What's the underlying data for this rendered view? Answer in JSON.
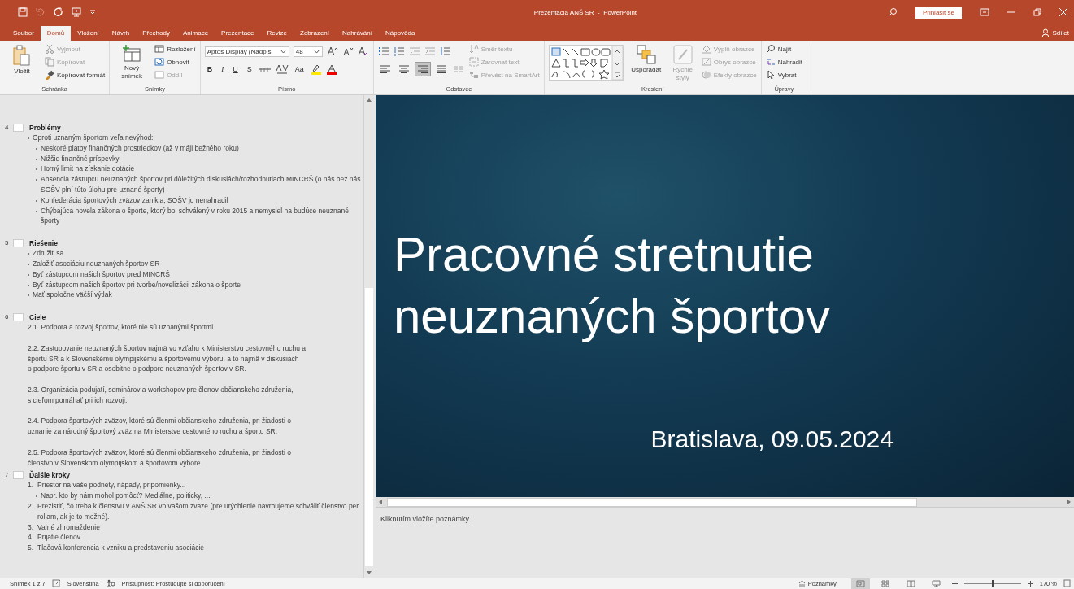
{
  "window": {
    "title": "Prezentácia ANŠ SR  -  PowerPoint",
    "sign_in": "Přihlásit se",
    "share": "Sdílet"
  },
  "tabs": [
    {
      "label": "Soubor",
      "selected": false
    },
    {
      "label": "Domů",
      "selected": true
    },
    {
      "label": "Vložení",
      "selected": false
    },
    {
      "label": "Návrh",
      "selected": false
    },
    {
      "label": "Přechody",
      "selected": false
    },
    {
      "label": "Animace",
      "selected": false
    },
    {
      "label": "Prezentace",
      "selected": false
    },
    {
      "label": "Revize",
      "selected": false
    },
    {
      "label": "Zobrazení",
      "selected": false
    },
    {
      "label": "Nahrávání",
      "selected": false
    },
    {
      "label": "Nápověda",
      "selected": false
    }
  ],
  "ribbon": {
    "groups": [
      {
        "kind": "clipboard",
        "label": "Schránka",
        "big": "Vložit",
        "commands": [
          {
            "label": "Vyjmout",
            "disabled": true
          },
          {
            "label": "Kopírovat",
            "disabled": true
          },
          {
            "label": "Kopírovat formát",
            "disabled": false
          }
        ]
      },
      {
        "kind": "slides",
        "label": "Snímky",
        "big": "Nový snímek",
        "commands": [
          {
            "label": "Rozložení",
            "disabled": false
          },
          {
            "label": "Obnovit",
            "disabled": false
          },
          {
            "label": "Oddíl",
            "disabled": true
          }
        ]
      },
      {
        "kind": "font",
        "label": "Písmo",
        "font_name": "Aptos Display (Nadpis",
        "font_size": "48",
        "format_buttons": [
          "B",
          "I",
          "U",
          "S"
        ],
        "case": "Aa"
      },
      {
        "kind": "paragraph",
        "label": "Odstavec",
        "alignment": [
          {
            "selected": false
          },
          {
            "selected": false
          },
          {
            "selected": true
          },
          {
            "selected": false
          }
        ],
        "commands": [
          {
            "label": "Směr textu",
            "disabled": true
          },
          {
            "label": "Zarovnat text",
            "disabled": true
          },
          {
            "label": "Převést na SmartArt",
            "disabled": true
          }
        ]
      },
      {
        "kind": "drawing",
        "label": "Kreslení",
        "big": "Uspořádat",
        "quick_styles": "Rychlé styly",
        "commands": [
          {
            "label": "Výplň obrazce",
            "disabled": true
          },
          {
            "label": "Obrys obrazce",
            "disabled": true
          },
          {
            "label": "Efekty obrazce",
            "disabled": true
          }
        ]
      },
      {
        "kind": "editing",
        "label": "Úpravy",
        "commands": [
          {
            "label": "Najít",
            "disabled": false
          },
          {
            "label": "Nahradit",
            "disabled": false
          },
          {
            "label": "Vybrat",
            "disabled": false
          }
        ]
      }
    ]
  },
  "outline": {
    "slides": [
      {
        "number": "4",
        "title": "Problémy",
        "items": [
          {
            "kind": "bullet",
            "text": "Oproti uznaným športom veľa nevýhod:",
            "children": [
              {
                "kind": "bullet",
                "text": "Neskoré platby finančných prostriedkov (až v máji bežného roku)"
              },
              {
                "kind": "bullet",
                "text": "Nižšie finančné príspevky"
              },
              {
                "kind": "bullet",
                "text": "Horný limit na získanie dotácie"
              },
              {
                "kind": "bullet",
                "text": "Absencia zástupcu neuznaných športov pri dôležitých diskusiách/rozhodnutiach MINCRŠ (o nás bez nás. SOŠV plní túto úlohu pre uznané športy)"
              },
              {
                "kind": "bullet",
                "text": "Konfederácia športových zväzov zanikla, SOŠV ju nenahradil"
              },
              {
                "kind": "bullet",
                "text": "Chýbajúca novela zákona o športe, ktorý bol schválený v roku 2015 a nemyslel na budúce neuznané športy"
              }
            ]
          }
        ]
      },
      {
        "number": "5",
        "title": "Riešenie",
        "items": [
          {
            "kind": "bullet",
            "text": "Združiť sa"
          },
          {
            "kind": "bullet",
            "text": "Založiť asociáciu neuznaných športov SR"
          },
          {
            "kind": "bullet",
            "text": "Byť zástupcom našich športov pred MINCRŠ"
          },
          {
            "kind": "bullet",
            "text": "Byť zástupcom našich športov pri tvorbe/novelizácii zákona o športe"
          },
          {
            "kind": "bullet",
            "text": "Mať spoločne väčší výtlak"
          }
        ]
      },
      {
        "number": "6",
        "title": "Ciele",
        "items": [
          {
            "kind": "paragraph",
            "lines": [
              "2.1. Podpora a rozvoj športov, ktoré nie sú uznanými športmi"
            ]
          },
          {
            "kind": "paragraph",
            "lines": [
              "2.2. Zastupovanie neuznaných športov najmä vo vzťahu k Ministerstvu cestovného ruchu a",
              "športu SR a k Slovenskému olympijskému a športovému výboru, a to najmä v diskusiách",
              "o podpore športu v SR a osobitne o podpore neuznaných športov v SR."
            ]
          },
          {
            "kind": "paragraph",
            "lines": [
              "2.3. Organizácia podujatí, seminárov a workshopov pre členov občianskeho združenia,",
              "s cieľom pomáhať pri ich rozvoji."
            ]
          },
          {
            "kind": "paragraph",
            "lines": [
              "2.4. Podpora športových zväzov, ktoré sú členmi občianskeho združenia, pri žiadosti o",
              "uznanie za národný športový zväz na Ministerstve cestovného ruchu a športu SR."
            ]
          },
          {
            "kind": "paragraph",
            "lines": [
              "2.5. Podpora športových zväzov, ktoré sú členmi občianskeho združenia, pri žiadosti o",
              "členstvo v Slovenskom olympijskom a športovom výbore."
            ]
          }
        ]
      },
      {
        "number": "7",
        "title": "Ďalšie kroky",
        "items": [
          {
            "kind": "numbered",
            "number": "1.",
            "text": "Priestor na vaše podnety, nápady, pripomienky...",
            "children": [
              {
                "kind": "bullet",
                "text": "Napr. kto by nám mohol pomôcť? Mediálne, politicky, ..."
              }
            ]
          },
          {
            "kind": "numbered",
            "number": "2.",
            "text": "Prezistiť, čo treba k členstvu v ANŠ SR vo vašom zväze (pre urýchlenie navrhujeme schváliť členstvo per rollam, ak je to možné)."
          },
          {
            "kind": "numbered",
            "number": "3.",
            "text": "Valné zhromaždenie"
          },
          {
            "kind": "numbered",
            "number": "4.",
            "text": "Prijatie členov"
          },
          {
            "kind": "numbered",
            "number": "5.",
            "text": "Tlačová konferencia k vzniku a predstaveniu asociácie"
          }
        ]
      }
    ]
  },
  "slide": {
    "title": "Pracovné stretnutie neuznaných športov",
    "subtitle": "Bratislava, 09.05.2024"
  },
  "notes": {
    "placeholder": "Kliknutím vložíte poznámky."
  },
  "status_bar": {
    "slide_counter": "Snímek 1 z 7",
    "language": "Slovenština",
    "accessibility": "Přístupnost: Prostudujte si doporučení",
    "notes_button": "Poznámky",
    "views": [
      {
        "selected": true
      },
      {
        "selected": false
      },
      {
        "selected": false
      },
      {
        "selected": false
      }
    ],
    "zoom": {
      "level": 0.5,
      "reading": "170 %"
    }
  }
}
